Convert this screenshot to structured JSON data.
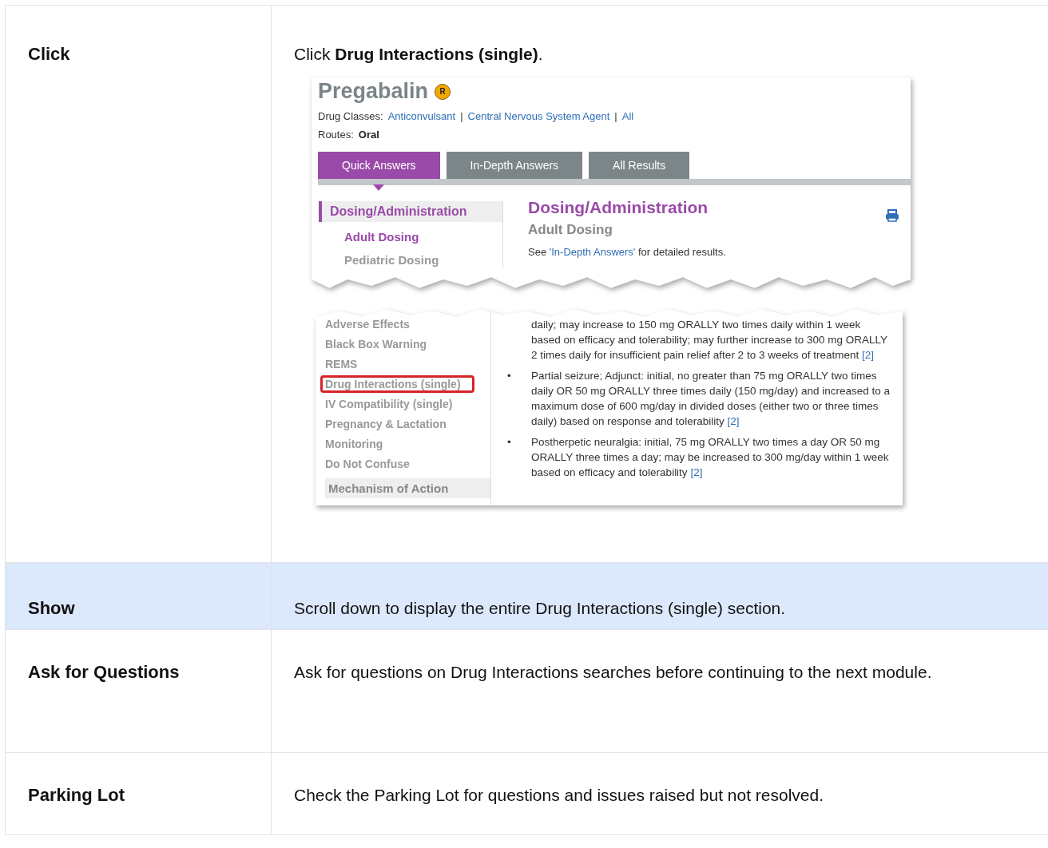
{
  "steps": [
    {
      "label": "Click",
      "text": "Click **Drug Interactions (single)**.",
      "highlighted": false,
      "kind": "screenshot"
    },
    {
      "label": "Show",
      "text": "Scroll down to display the entire Drug Interactions (single) section.",
      "highlighted": true,
      "kind": "plain"
    },
    {
      "label": "Ask for Questions",
      "text": "Ask for questions on Drug Interactions searches before continuing to the next module.",
      "highlighted": false,
      "kind": "plain"
    },
    {
      "label": "Parking Lot",
      "text": "Check the Parking Lot for questions and issues raised but not resolved.",
      "highlighted": false,
      "kind": "plain"
    }
  ],
  "screenshot": {
    "drug": {
      "name": "Pregabalin",
      "badge": "R",
      "classes_label": "Drug Classes:",
      "classes": [
        "Anticonvulsant",
        "Central Nervous System Agent",
        "All"
      ],
      "separator": "|",
      "routes_label": "Routes:",
      "route": "Oral"
    },
    "tabs": [
      {
        "label": "Quick Answers",
        "selected": true
      },
      {
        "label": "In-Depth Answers",
        "selected": false
      },
      {
        "label": "All Results",
        "selected": false
      }
    ],
    "top_sidebar": [
      {
        "label": "Dosing/Administration",
        "kind": "section",
        "selected": true
      },
      {
        "label": "Adult Dosing",
        "kind": "sub",
        "selected": true
      },
      {
        "label": "Pediatric Dosing",
        "kind": "sub",
        "selected": false
      }
    ],
    "heading": "Dosing/Administration",
    "subheading": "Adult Dosing",
    "note": {
      "before": "See ",
      "link": "'In-Depth Answers'",
      "after": " for detailed results."
    },
    "lower_sidebar": [
      {
        "label": "Adverse Effects",
        "outlined": false
      },
      {
        "label": "Black Box Warning",
        "outlined": false
      },
      {
        "label": "REMS",
        "outlined": false
      },
      {
        "label": "Drug Interactions (single)",
        "outlined": true
      },
      {
        "label": "IV Compatibility (single)",
        "outlined": false
      },
      {
        "label": "Pregnancy & Lactation",
        "outlined": false
      },
      {
        "label": "Monitoring",
        "outlined": false
      },
      {
        "label": "Do Not Confuse",
        "outlined": false
      }
    ],
    "lower_section": "Mechanism of Action",
    "paragraphs": [
      {
        "text": "daily; may increase to 150 mg ORALLY two times daily within 1 week based on efficacy and tolerability; may further increase to 300 mg ORALLY 2 times daily for insufficient pain relief after 2 to 3 weeks of treatment",
        "ref": "[2]"
      },
      {
        "text": "Partial seizure; Adjunct: initial, no greater than 75 mg ORALLY two times daily OR 50 mg ORALLY three times daily (150 mg/day) and increased to a maximum dose of 600 mg/day in divided doses (either two or three times daily) based on response and tolerability",
        "ref": "[2]",
        "marker": "•"
      },
      {
        "text": "Postherpetic neuralgia: initial, 75 mg ORALLY two times a day OR 50 mg ORALLY three times a day; may be increased to 300 mg/day within 1 week based on efficacy and tolerability",
        "ref": "[2]",
        "marker": "•"
      }
    ]
  }
}
